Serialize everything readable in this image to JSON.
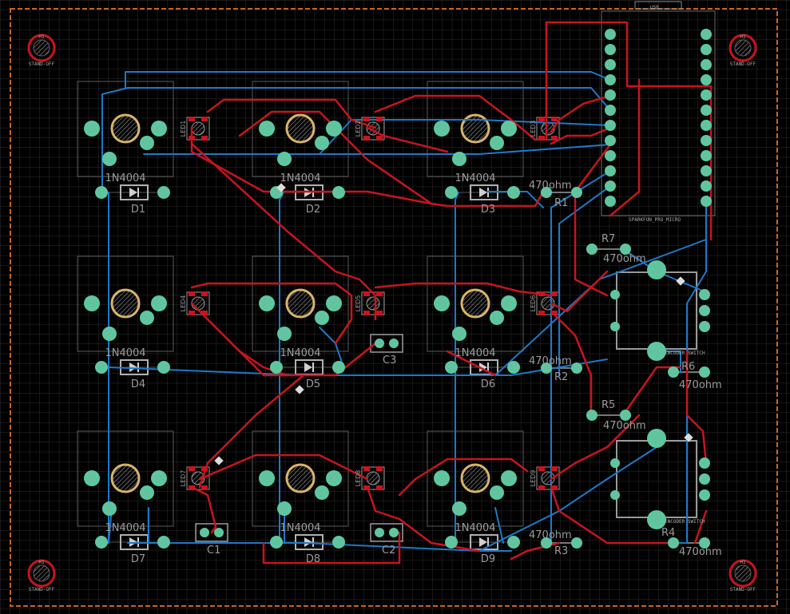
{
  "colors": {
    "background": "#000000",
    "grid": "#2a2a2a",
    "outline": "#c8641e",
    "top_copper": "#c8141e",
    "bottom_copper": "#1e78c8",
    "pad": "#5cc8a0",
    "silkscreen": "#8a8a8a",
    "switch_center": "#d8b468"
  },
  "labels": {
    "usb": "USB",
    "mcu": "SPARKFUN_PRO_MICRO",
    "standoff": "STAND-OFF",
    "hole": "H1",
    "encoder1": "ENCODER SWITCH",
    "encoder2": "ENCODER SWITCH"
  },
  "diodes": [
    {
      "ref": "D1",
      "value": "1N4004"
    },
    {
      "ref": "D2",
      "value": "1N4004"
    },
    {
      "ref": "D3",
      "value": "1N4004"
    },
    {
      "ref": "D4",
      "value": "1N4004"
    },
    {
      "ref": "D5",
      "value": "1N4004"
    },
    {
      "ref": "D6",
      "value": "1N4004"
    },
    {
      "ref": "D7",
      "value": "1N4004"
    },
    {
      "ref": "D8",
      "value": "1N4004"
    },
    {
      "ref": "D9",
      "value": "1N4004"
    }
  ],
  "leds": [
    "LED1",
    "LED2",
    "LED3",
    "LED4",
    "LED5",
    "LED6",
    "LED7",
    "LED8",
    "LED9"
  ],
  "resistors": [
    {
      "ref": "R1",
      "value": "470ohm"
    },
    {
      "ref": "R2",
      "value": "470ohm"
    },
    {
      "ref": "R3",
      "value": "470ohm"
    },
    {
      "ref": "R4",
      "value": "470ohm"
    },
    {
      "ref": "R5",
      "value": "470ohm"
    },
    {
      "ref": "R6",
      "value": "470ohm"
    },
    {
      "ref": "R7",
      "value": "470ohm"
    }
  ],
  "capacitors": [
    "C1",
    "C2",
    "C3"
  ]
}
